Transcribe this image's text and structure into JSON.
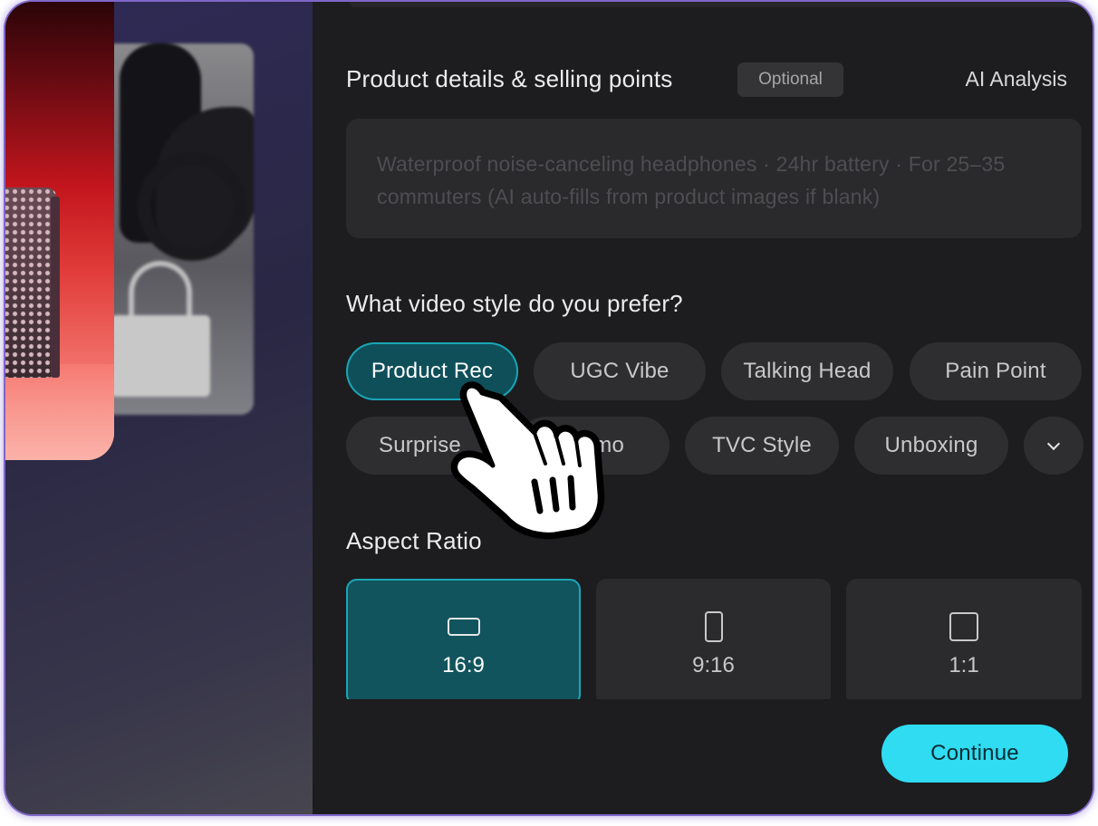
{
  "details": {
    "title": "Product details & selling points",
    "badge": "Optional",
    "ai_link": "AI Analysis",
    "placeholder": "Waterproof noise-canceling headphones · 24hr battery · For 25–35 commuters (AI auto-fills from product images if blank)"
  },
  "style": {
    "question": "What video style do you prefer?",
    "selected": "Product Rec",
    "chips_row1": [
      "Product Rec",
      "UGC Vibe",
      "Talking Head",
      "Pain Point"
    ],
    "chips_row2": [
      "Surprise",
      "mo",
      "TVC Style",
      "Unboxing"
    ],
    "more_icon": "chevron-down-icon"
  },
  "aspect": {
    "title": "Aspect Ratio",
    "selected": "16:9",
    "options": [
      {
        "label": "16:9",
        "icon": "landscape-icon"
      },
      {
        "label": "9:16",
        "icon": "portrait-icon"
      },
      {
        "label": "1:1",
        "icon": "square-icon"
      }
    ]
  },
  "actions": {
    "continue_label": "Continue"
  },
  "colors": {
    "accent": "#2fdcf2",
    "selected_fill": "#0f4f5a",
    "selected_border": "#1aa5b6",
    "panel_bg": "#1d1d1f"
  }
}
